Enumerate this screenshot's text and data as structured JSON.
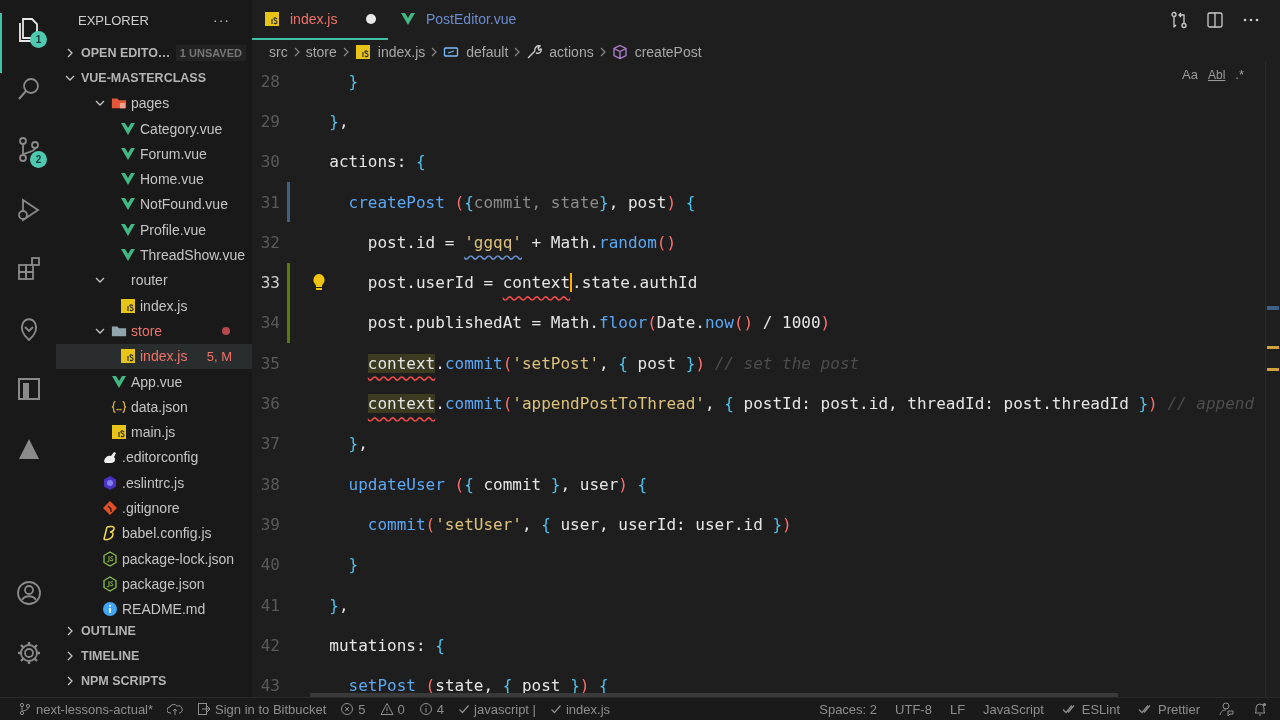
{
  "activity_bar": {
    "items": [
      {
        "kind": "files",
        "selected": true,
        "badge": "1"
      },
      {
        "kind": "search",
        "selected": false
      },
      {
        "kind": "source-control",
        "selected": false,
        "badge": "2"
      },
      {
        "kind": "debug",
        "selected": false
      },
      {
        "kind": "extensions",
        "selected": false
      },
      {
        "kind": "pin",
        "selected": false
      },
      {
        "kind": "box",
        "selected": false
      },
      {
        "kind": "triangle",
        "selected": false
      }
    ],
    "bottom_items": [
      {
        "kind": "account"
      },
      {
        "kind": "settings"
      }
    ]
  },
  "sidebar": {
    "title": "EXPLORER",
    "more": "···",
    "open_editors": {
      "label": "OPEN EDITO…",
      "badge": "1 UNSAVED",
      "expanded": false
    },
    "project": {
      "label": "VUE-MASTERCLASS",
      "expanded": true,
      "children": [
        {
          "kind": "scrolled",
          "children": [
            {
              "label": "pages",
              "kind": "pages-folder",
              "expanded": true,
              "selected": false,
              "modified": false,
              "children": [
                {
                  "label": "Category.vue",
                  "kind": "vue",
                  "selected": false,
                  "modified": false
                },
                {
                  "label": "Forum.vue",
                  "kind": "vue",
                  "selected": false,
                  "modified": false
                },
                {
                  "label": "Home.vue",
                  "kind": "vue",
                  "selected": false,
                  "modified": false
                },
                {
                  "label": "NotFound.vue",
                  "kind": "vue",
                  "selected": false,
                  "modified": false
                },
                {
                  "label": "Profile.vue",
                  "kind": "vue",
                  "selected": false,
                  "modified": false
                },
                {
                  "label": "ThreadShow.vue",
                  "kind": "vue",
                  "selected": false,
                  "modified": false
                }
              ]
            },
            {
              "label": "router",
              "kind": "bare",
              "expanded": true,
              "selected": false,
              "modified": false,
              "children": [
                {
                  "label": "index.js",
                  "kind": "js",
                  "selected": false,
                  "modified": false
                }
              ]
            },
            {
              "label": "store",
              "kind": "folder",
              "expanded": true,
              "selected": false,
              "modified": true,
              "children": [
                {
                  "label": "index.js",
                  "kind": "js",
                  "selected": true,
                  "modified": true,
                  "badge": "5, M"
                }
              ]
            },
            {
              "label": "App.vue",
              "kind": "vue",
              "selected": false,
              "modified": false
            },
            {
              "label": "data.json",
              "kind": "json",
              "selected": false,
              "modified": false
            },
            {
              "label": "main.js",
              "kind": "js",
              "selected": false,
              "modified": false
            }
          ]
        },
        {
          "label": ".editorconfig",
          "kind": "editorconfig",
          "selected": false,
          "modified": false
        },
        {
          "label": ".eslintrc.js",
          "kind": "eslint",
          "selected": false,
          "modified": false
        },
        {
          "label": ".gitignore",
          "kind": "git",
          "selected": false,
          "modified": false
        },
        {
          "label": "babel.config.js",
          "kind": "babel",
          "selected": false,
          "modified": false
        },
        {
          "label": "package-lock.json",
          "kind": "node",
          "selected": false,
          "modified": false
        },
        {
          "label": "package.json",
          "kind": "node",
          "selected": false,
          "modified": false
        },
        {
          "label": "README.md",
          "kind": "info",
          "selected": false,
          "modified": false
        }
      ]
    },
    "sections": [
      {
        "label": "OUTLINE",
        "expanded": false
      },
      {
        "label": "TIMELINE",
        "expanded": false
      },
      {
        "label": "NPM SCRIPTS",
        "expanded": false
      }
    ]
  },
  "tabs": [
    {
      "label": "index.js",
      "kind": "js",
      "selected": true,
      "dirty": true,
      "has_errors": true
    },
    {
      "label": "PostEditor.vue",
      "kind": "vue",
      "selected": false,
      "dirty": false,
      "has_errors": false
    }
  ],
  "breadcrumbs": [
    {
      "label": "src",
      "kind": "folder"
    },
    {
      "label": "store",
      "kind": "folder"
    },
    {
      "label": "index.js",
      "kind": "js"
    },
    {
      "label": "default",
      "kind": "object"
    },
    {
      "label": "actions",
      "kind": "method"
    },
    {
      "label": "createPost",
      "kind": "property"
    }
  ],
  "find_widget": {
    "options": [
      {
        "label": "Aa",
        "kind": "case"
      },
      {
        "label": "Abl",
        "kind": "word"
      },
      {
        "label": ".*",
        "kind": "regex"
      }
    ]
  },
  "editor": {
    "lines": [
      {
        "number": "28",
        "current": false,
        "tokens": [
          {
            "t": "    }",
            "kind": "brace"
          }
        ]
      },
      {
        "number": "29",
        "current": false,
        "tokens": [
          {
            "t": "  }",
            "kind": "brace"
          },
          {
            "t": ",",
            "kind": "plain"
          }
        ]
      },
      {
        "number": "30",
        "current": false,
        "tokens": [
          {
            "t": "  actions:",
            "kind": "plain"
          },
          {
            "t": " {",
            "kind": "brace"
          }
        ]
      },
      {
        "number": "31",
        "current": false,
        "modified": true,
        "tokens": [
          {
            "t": "    createPost",
            "kind": "fn"
          },
          {
            "t": " (",
            "kind": "paren"
          },
          {
            "t": "{",
            "kind": "brace"
          },
          {
            "t": "commit, state",
            "kind": "unused"
          },
          {
            "t": "}",
            "kind": "brace"
          },
          {
            "t": ", post",
            "kind": "plain"
          },
          {
            "t": ")",
            "kind": "paren"
          },
          {
            "t": " {",
            "kind": "brace"
          }
        ]
      },
      {
        "number": "32",
        "current": false,
        "tokens": [
          {
            "t": "      post.id = ",
            "kind": "plain"
          },
          {
            "t": "'ggqq'",
            "kind": "str",
            "info": true
          },
          {
            "t": " + Math.",
            "kind": "plain"
          },
          {
            "t": "random",
            "kind": "fn"
          },
          {
            "t": "()",
            "kind": "paren"
          }
        ]
      },
      {
        "number": "33",
        "current": true,
        "lightbulb": true,
        "added": true,
        "tokens": [
          {
            "t": "      post.userId = ",
            "kind": "plain"
          },
          {
            "t": "context",
            "kind": "plain",
            "error": true,
            "cursor_after": true
          },
          {
            "t": ".state.authId",
            "kind": "plain"
          }
        ]
      },
      {
        "number": "34",
        "current": false,
        "added": true,
        "tokens": [
          {
            "t": "      post.publishedAt = Math.",
            "kind": "plain"
          },
          {
            "t": "floor",
            "kind": "fn"
          },
          {
            "t": "(",
            "kind": "paren"
          },
          {
            "t": "Date.",
            "kind": "plain"
          },
          {
            "t": "now",
            "kind": "fn"
          },
          {
            "t": "()",
            "kind": "paren"
          },
          {
            "t": " / 1000",
            "kind": "plain"
          },
          {
            "t": ")",
            "kind": "paren"
          }
        ]
      },
      {
        "number": "35",
        "current": false,
        "tokens": [
          {
            "t": "      context",
            "kind": "plain",
            "error": true,
            "highlight": true
          },
          {
            "t": ".",
            "kind": "plain"
          },
          {
            "t": "commit",
            "kind": "fn"
          },
          {
            "t": "(",
            "kind": "paren"
          },
          {
            "t": "'setPost'",
            "kind": "str"
          },
          {
            "t": ", ",
            "kind": "plain"
          },
          {
            "t": "{",
            "kind": "brace"
          },
          {
            "t": " post ",
            "kind": "plain"
          },
          {
            "t": "}",
            "kind": "brace"
          },
          {
            "t": ")",
            "kind": "paren"
          },
          {
            "t": " // set the post",
            "kind": "comment"
          }
        ]
      },
      {
        "number": "36",
        "current": false,
        "tokens": [
          {
            "t": "      context",
            "kind": "plain",
            "error": true,
            "highlight": true
          },
          {
            "t": ".",
            "kind": "plain"
          },
          {
            "t": "commit",
            "kind": "fn"
          },
          {
            "t": "(",
            "kind": "paren"
          },
          {
            "t": "'appendPostToThread'",
            "kind": "str"
          },
          {
            "t": ", ",
            "kind": "plain"
          },
          {
            "t": "{",
            "kind": "brace"
          },
          {
            "t": " postId: post.id, threadId: post.threadId ",
            "kind": "plain"
          },
          {
            "t": "}",
            "kind": "brace"
          },
          {
            "t": ")",
            "kind": "paren"
          },
          {
            "t": " // append",
            "kind": "comment"
          }
        ]
      },
      {
        "number": "37",
        "current": false,
        "tokens": [
          {
            "t": "    }",
            "kind": "brace"
          },
          {
            "t": ",",
            "kind": "plain"
          }
        ]
      },
      {
        "number": "38",
        "current": false,
        "tokens": [
          {
            "t": "    updateUser",
            "kind": "fn"
          },
          {
            "t": " (",
            "kind": "paren"
          },
          {
            "t": "{",
            "kind": "brace"
          },
          {
            "t": " commit ",
            "kind": "plain"
          },
          {
            "t": "}",
            "kind": "brace"
          },
          {
            "t": ", user",
            "kind": "plain"
          },
          {
            "t": ")",
            "kind": "paren"
          },
          {
            "t": " {",
            "kind": "brace"
          }
        ]
      },
      {
        "number": "39",
        "current": false,
        "tokens": [
          {
            "t": "      commit",
            "kind": "fn"
          },
          {
            "t": "(",
            "kind": "paren"
          },
          {
            "t": "'setUser'",
            "kind": "str"
          },
          {
            "t": ", ",
            "kind": "plain"
          },
          {
            "t": "{",
            "kind": "brace"
          },
          {
            "t": " user, userId: user.id ",
            "kind": "plain"
          },
          {
            "t": "}",
            "kind": "brace"
          },
          {
            "t": ")",
            "kind": "paren"
          }
        ]
      },
      {
        "number": "40",
        "current": false,
        "tokens": [
          {
            "t": "    }",
            "kind": "brace"
          }
        ]
      },
      {
        "number": "41",
        "current": false,
        "tokens": [
          {
            "t": "  }",
            "kind": "brace"
          },
          {
            "t": ",",
            "kind": "plain"
          }
        ]
      },
      {
        "number": "42",
        "current": false,
        "tokens": [
          {
            "t": "  mutations:",
            "kind": "plain"
          },
          {
            "t": " {",
            "kind": "brace"
          }
        ]
      },
      {
        "number": "43",
        "current": false,
        "tokens": [
          {
            "t": "    setPost",
            "kind": "fn"
          },
          {
            "t": " (",
            "kind": "paren"
          },
          {
            "t": "state, ",
            "kind": "plain"
          },
          {
            "t": "{",
            "kind": "brace"
          },
          {
            "t": " post ",
            "kind": "plain"
          },
          {
            "t": "}",
            "kind": "brace"
          },
          {
            "t": ")",
            "kind": "paren"
          },
          {
            "t": " {",
            "kind": "brace"
          }
        ]
      }
    ]
  },
  "status_bar": {
    "left": [
      {
        "kind": "branch",
        "label": "next-lessons-actual*"
      },
      {
        "kind": "cloud"
      },
      {
        "kind": "signin",
        "label": "Sign in to Bitbucket"
      },
      {
        "kind": "error",
        "label": "5"
      },
      {
        "kind": "warning",
        "label": "0"
      },
      {
        "kind": "info",
        "label": "4"
      },
      {
        "kind": "check",
        "label": "javascript |"
      },
      {
        "kind": "check",
        "label": "index.js"
      }
    ],
    "right": [
      {
        "kind": "text",
        "label": "Spaces: 2"
      },
      {
        "kind": "text",
        "label": "UTF-8"
      },
      {
        "kind": "text",
        "label": "LF"
      },
      {
        "kind": "text",
        "label": "JavaScript"
      },
      {
        "kind": "doublecheck",
        "label": "ESLint"
      },
      {
        "kind": "doublecheck",
        "label": "Prettier"
      },
      {
        "kind": "feedback"
      },
      {
        "kind": "bell"
      }
    ]
  }
}
